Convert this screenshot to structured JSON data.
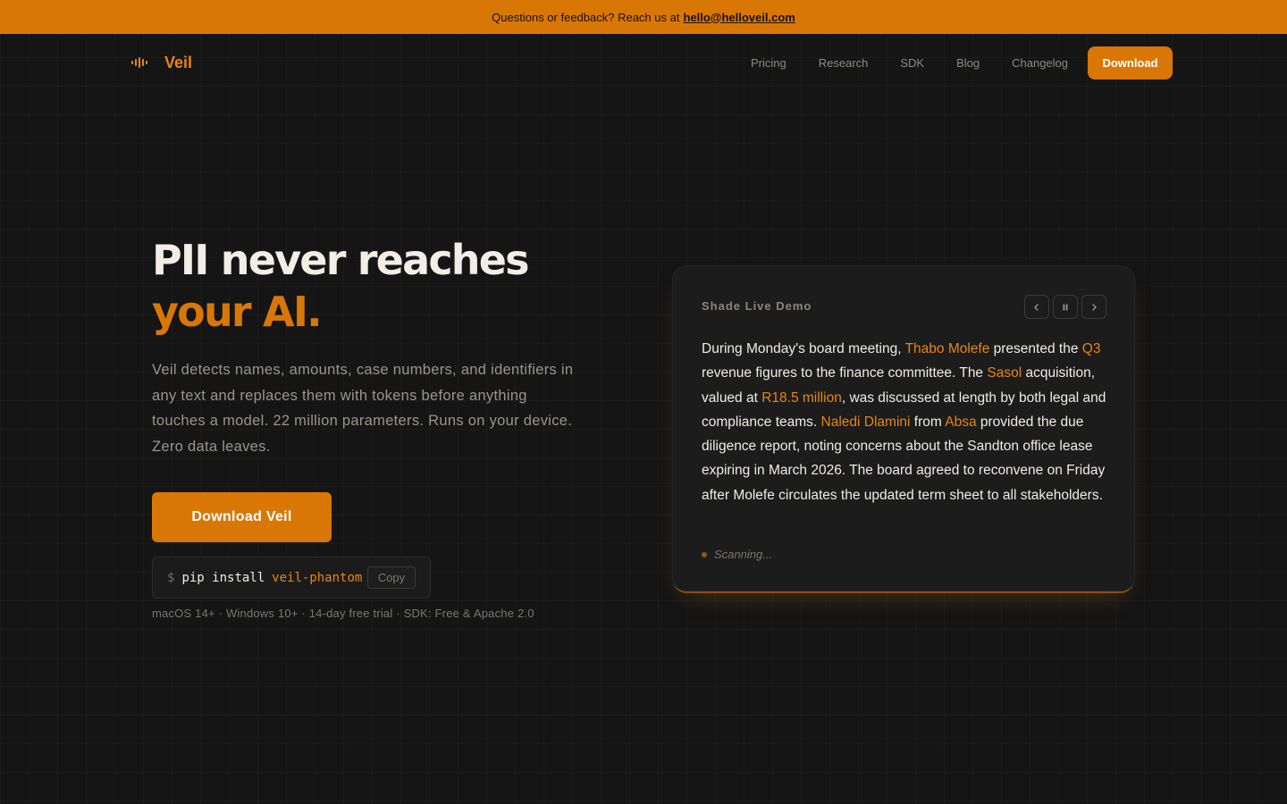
{
  "banner": {
    "text": "Questions or feedback? Reach us at",
    "email": "hello@helloveil.com"
  },
  "nav": {
    "brand": "Veil",
    "links": [
      "Pricing",
      "Research",
      "SDK",
      "Blog",
      "Changelog"
    ],
    "download_label": "Download"
  },
  "hero": {
    "title_line1": "PII never reaches",
    "title_line2": "your AI.",
    "description": "Veil detects names, amounts, case numbers, and identifiers in any text and replaces them with tokens before anything touches a model. 22 million parameters. Runs on your device. Zero data leaves.",
    "cta_label": "Download Veil",
    "install": {
      "prompt": "$",
      "command": "pip install",
      "package": "veil-phantom",
      "copy_label": "Copy"
    },
    "meta": "macOS 14+ · Windows 10+ · 14-day free trial · SDK: Free & Apache 2.0"
  },
  "demo": {
    "title": "Shade Live Demo",
    "segments": [
      {
        "text": "During Monday's board meeting, ",
        "highlight": false
      },
      {
        "text": "Thabo Molefe",
        "highlight": true
      },
      {
        "text": " presented the ",
        "highlight": false
      },
      {
        "text": "Q3",
        "highlight": true
      },
      {
        "text": " revenue figures to the finance committee. The ",
        "highlight": false
      },
      {
        "text": "Sasol",
        "highlight": true
      },
      {
        "text": " acquisition, valued at ",
        "highlight": false
      },
      {
        "text": "R18.5 million",
        "highlight": true
      },
      {
        "text": ", was discussed at length by both legal and compliance teams. ",
        "highlight": false
      },
      {
        "text": "Naledi Dlamini",
        "highlight": true
      },
      {
        "text": " from ",
        "highlight": false
      },
      {
        "text": "Absa",
        "highlight": true
      },
      {
        "text": " provided the due diligence report, noting concerns about the Sandton office lease expiring in March 2026. The board agreed to reconvene on Friday after Molefe circulates the updated term sheet to all stakeholders.",
        "highlight": false
      }
    ],
    "status": "Scanning..."
  },
  "colors": {
    "accent": "#d97706",
    "highlight": "#e8860f",
    "background": "#151515"
  }
}
